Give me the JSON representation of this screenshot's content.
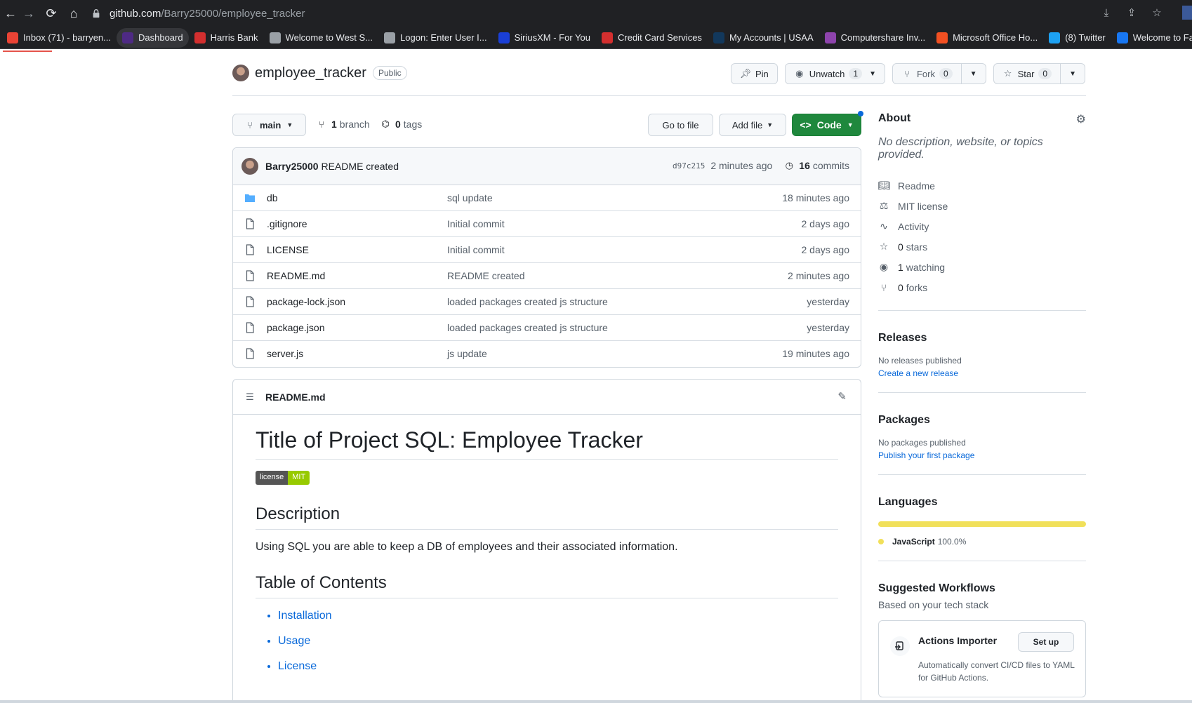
{
  "browser": {
    "url_host": "github.com",
    "url_path": "/Barry25000/employee_tracker",
    "bookmarks": [
      {
        "label": "Inbox (71) - barryen...",
        "icon": "gmail-icon",
        "color": "#ea4335"
      },
      {
        "label": "Dashboard",
        "icon": "northwestern-icon",
        "color": "#4e2a84"
      },
      {
        "label": "Harris Bank",
        "icon": "bank-icon",
        "color": "#d32f2f"
      },
      {
        "label": "Welcome to West S...",
        "icon": "globe-icon",
        "color": "#9aa0a6"
      },
      {
        "label": "Logon: Enter User I...",
        "icon": "globe-icon",
        "color": "#9aa0a6"
      },
      {
        "label": "SiriusXM - For You",
        "icon": "siriusxm-icon",
        "color": "#1a3fd6"
      },
      {
        "label": "Credit Card Services",
        "icon": "card-icon",
        "color": "#d32f2f"
      },
      {
        "label": "My Accounts | USAA",
        "icon": "usaa-icon",
        "color": "#12385c"
      },
      {
        "label": "Computershare Inv...",
        "icon": "computershare-icon",
        "color": "#8e44ad"
      },
      {
        "label": "Microsoft Office Ho...",
        "icon": "microsoft-icon",
        "color": "#f25022"
      },
      {
        "label": "(8) Twitter",
        "icon": "twitter-icon",
        "color": "#1da1f2"
      },
      {
        "label": "Welcome to Facebo...",
        "icon": "facebook-icon",
        "color": "#1877f2"
      }
    ]
  },
  "repo": {
    "name": "employee_tracker",
    "visibility": "Public",
    "pin_label": "Pin",
    "watch_label": "Unwatch",
    "watch_count": "1",
    "fork_label": "Fork",
    "fork_count": "0",
    "star_label": "Star",
    "star_count": "0"
  },
  "filenav": {
    "branch": "main",
    "branch_count": "1",
    "branch_word": "branch",
    "tag_count": "0",
    "tag_word": "tags",
    "goto_label": "Go to file",
    "addfile_label": "Add file",
    "code_label": "Code"
  },
  "commit": {
    "author": "Barry25000",
    "message": "README created",
    "sha": "d97c215",
    "age": "2 minutes ago",
    "count": "16",
    "count_word": "commits"
  },
  "files": [
    {
      "name": "db",
      "type": "folder",
      "message": "sql update",
      "age": "18 minutes ago"
    },
    {
      "name": ".gitignore",
      "type": "file",
      "message": "Initial commit",
      "age": "2 days ago"
    },
    {
      "name": "LICENSE",
      "type": "file",
      "message": "Initial commit",
      "age": "2 days ago"
    },
    {
      "name": "README.md",
      "type": "file",
      "message": "README created",
      "age": "2 minutes ago"
    },
    {
      "name": "package-lock.json",
      "type": "file",
      "message": "loaded packages created js structure",
      "age": "yesterday"
    },
    {
      "name": "package.json",
      "type": "file",
      "message": "loaded packages created js structure",
      "age": "yesterday"
    },
    {
      "name": "server.js",
      "type": "file",
      "message": "js update",
      "age": "19 minutes ago"
    }
  ],
  "readme": {
    "filename": "README.md",
    "title": "Title of Project SQL: Employee Tracker",
    "badge_left": "license",
    "badge_right": "MIT",
    "description_heading": "Description",
    "description_text": "Using SQL you are able to keep a DB of employees and their associated information.",
    "toc_heading": "Table of Contents",
    "toc": [
      "Installation",
      "Usage",
      "License"
    ]
  },
  "sidebar": {
    "about_heading": "About",
    "about_desc": "No description, website, or topics provided.",
    "items": [
      {
        "icon": "book-icon",
        "label": "Readme",
        "count": ""
      },
      {
        "icon": "scale-icon",
        "label": "MIT license",
        "count": ""
      },
      {
        "icon": "pulse-icon",
        "label": "Activity",
        "count": ""
      },
      {
        "icon": "star-icon",
        "label": "stars",
        "count": "0"
      },
      {
        "icon": "eye-icon",
        "label": "watching",
        "count": "1"
      },
      {
        "icon": "fork-icon",
        "label": "forks",
        "count": "0"
      }
    ],
    "releases_heading": "Releases",
    "releases_none": "No releases published",
    "releases_link": "Create a new release",
    "packages_heading": "Packages",
    "packages_none": "No packages published",
    "packages_link": "Publish your first package",
    "languages_heading": "Languages",
    "language_name": "JavaScript",
    "language_pct": "100.0%",
    "language_color": "#f1e05a",
    "workflows_heading": "Suggested Workflows",
    "workflows_sub": "Based on your tech stack",
    "workflow_title": "Actions Importer",
    "workflow_desc": "Automatically convert CI/CD files to YAML for GitHub Actions.",
    "workflow_btn": "Set up"
  }
}
